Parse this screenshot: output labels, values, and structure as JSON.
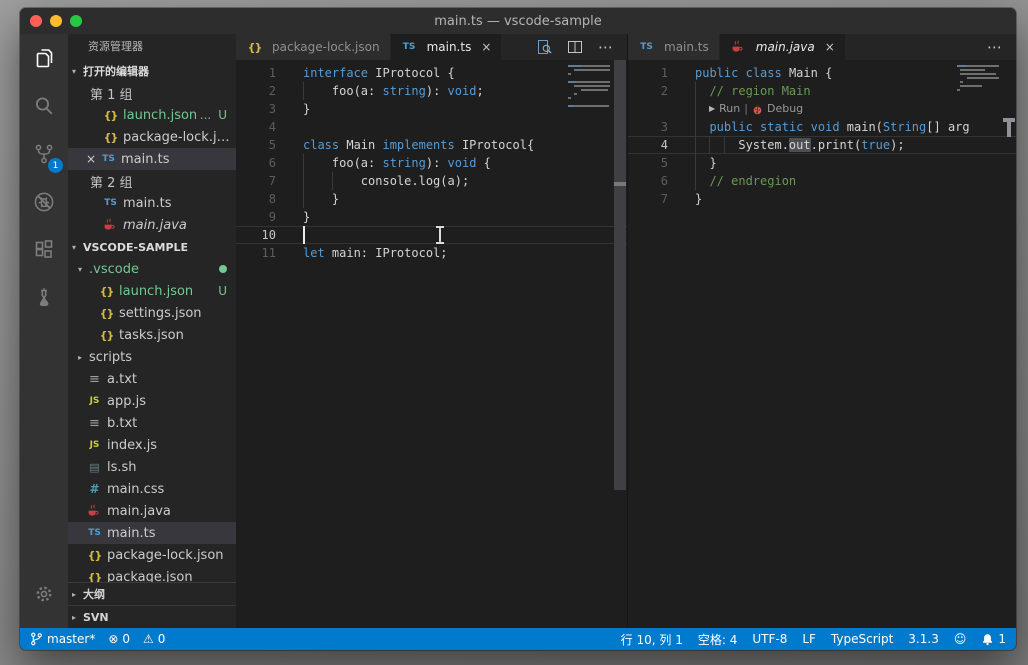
{
  "window": {
    "title": "main.ts — vscode-sample"
  },
  "colors": {
    "accent_blue": "#007acc",
    "editor_bg": "#1e1e1e",
    "sidebar_bg": "#252526",
    "activitybar_bg": "#333333",
    "titlebar_bg": "#2d2d2d",
    "keyword": "#569cd6",
    "comment": "#6a9955",
    "plain_text": "#d4d4d4",
    "git_untracked_green": "#73c991",
    "selection_row": "#37373d",
    "traffic_red": "#ff5f57",
    "traffic_yellow": "#febc2e",
    "traffic_green": "#28c840"
  },
  "activity_bar": {
    "items": [
      {
        "icon": "explorer-icon",
        "active": true
      },
      {
        "icon": "search-icon"
      },
      {
        "icon": "source-control-icon",
        "badge": "1"
      },
      {
        "icon": "debug-icon"
      },
      {
        "icon": "extensions-icon"
      },
      {
        "icon": "test-beaker-icon"
      }
    ],
    "bottom": [
      {
        "icon": "settings-gear-icon"
      }
    ]
  },
  "sidebar": {
    "title": "资源管理器",
    "rows": [
      {
        "kind": "section",
        "arrow": "open",
        "label": "打开的编辑器"
      },
      {
        "kind": "group",
        "label": "第 1 组"
      },
      {
        "kind": "item",
        "lvl": "oe",
        "icon": "json",
        "label": "launch.json",
        "color": "green",
        "badges": [
          "...",
          "U"
        ]
      },
      {
        "kind": "item",
        "lvl": "oe",
        "icon": "json",
        "label": "package-lock.json"
      },
      {
        "kind": "item",
        "lvl": "oe-sel",
        "icon": "ts",
        "label": "main.ts",
        "selected": true,
        "close": true
      },
      {
        "kind": "group",
        "label": "第 2 组"
      },
      {
        "kind": "item",
        "lvl": "oe",
        "icon": "ts",
        "label": "main.ts"
      },
      {
        "kind": "item",
        "lvl": "oe",
        "icon": "java",
        "label": "main.java",
        "italic": true
      },
      {
        "kind": "section",
        "arrow": "open",
        "label": "VSCODE-SAMPLE"
      },
      {
        "kind": "item",
        "lvl": "folder1",
        "arrow": "open",
        "label": ".vscode",
        "color": "green",
        "dot": true
      },
      {
        "kind": "item",
        "lvl": "l2",
        "icon": "json",
        "label": "launch.json",
        "color": "green",
        "badges": [
          "U"
        ]
      },
      {
        "kind": "item",
        "lvl": "l2",
        "icon": "json",
        "label": "settings.json"
      },
      {
        "kind": "item",
        "lvl": "l2",
        "icon": "json",
        "label": "tasks.json"
      },
      {
        "kind": "item",
        "lvl": "folder1",
        "arrow": "closed",
        "label": "scripts"
      },
      {
        "kind": "item",
        "lvl": "l1",
        "icon": "txt",
        "label": "a.txt"
      },
      {
        "kind": "item",
        "lvl": "l1",
        "icon": "js",
        "label": "app.js"
      },
      {
        "kind": "item",
        "lvl": "l1",
        "icon": "txt",
        "label": "b.txt"
      },
      {
        "kind": "item",
        "lvl": "l1",
        "icon": "js",
        "label": "index.js"
      },
      {
        "kind": "item",
        "lvl": "l1",
        "icon": "sh",
        "label": "ls.sh"
      },
      {
        "kind": "item",
        "lvl": "l1",
        "icon": "css",
        "label": "main.css"
      },
      {
        "kind": "item",
        "lvl": "l1",
        "icon": "java",
        "label": "main.java"
      },
      {
        "kind": "item",
        "lvl": "l1",
        "icon": "ts",
        "label": "main.ts",
        "selected": true
      },
      {
        "kind": "item",
        "lvl": "l1",
        "icon": "json",
        "label": "package-lock.json"
      },
      {
        "kind": "item",
        "lvl": "l1",
        "icon": "json",
        "label": "package.json"
      }
    ],
    "bottom_sections": [
      {
        "label": "大纲"
      },
      {
        "label": "SVN"
      }
    ]
  },
  "editors": {
    "left": {
      "tab_size": 4,
      "tabs": [
        {
          "icon": "json",
          "label": "package-lock.json"
        },
        {
          "icon": "ts",
          "label": "main.ts",
          "active": true,
          "close": true
        }
      ],
      "actions": [
        "open-preview-icon",
        "split-editor-icon",
        "more-actions-icon"
      ],
      "lines": [
        {
          "n": "1",
          "segs": [
            [
              "interface",
              "k"
            ],
            [
              " IProtocol {",
              "p"
            ]
          ]
        },
        {
          "n": "2",
          "segs": [
            [
              "    foo(a: ",
              "p"
            ],
            [
              "string",
              "k"
            ],
            [
              "): ",
              "p"
            ],
            [
              "void",
              "k"
            ],
            [
              ";",
              "p"
            ]
          ]
        },
        {
          "n": "3",
          "segs": [
            [
              "}",
              "p"
            ]
          ]
        },
        {
          "n": "4",
          "segs": []
        },
        {
          "n": "5",
          "segs": [
            [
              "class",
              "k"
            ],
            [
              " Main ",
              "p"
            ],
            [
              "implements",
              "k"
            ],
            [
              " IProtocol{",
              "p"
            ]
          ]
        },
        {
          "n": "6",
          "segs": [
            [
              "    foo(a: ",
              "p"
            ],
            [
              "string",
              "k"
            ],
            [
              "): ",
              "p"
            ],
            [
              "void",
              "k"
            ],
            [
              " {",
              "p"
            ]
          ]
        },
        {
          "n": "7",
          "segs": [
            [
              "        console.log(a);",
              "p"
            ]
          ]
        },
        {
          "n": "8",
          "segs": [
            [
              "    }",
              "p"
            ]
          ]
        },
        {
          "n": "9",
          "segs": [
            [
              "}",
              "p"
            ]
          ]
        },
        {
          "n": "10",
          "segs": [],
          "current": true,
          "cursor": true
        },
        {
          "n": "11",
          "segs": [
            [
              "let",
              "k"
            ],
            [
              " main: IProtocol;",
              "p"
            ]
          ]
        }
      ]
    },
    "right": {
      "tab_size": 2,
      "tabs": [
        {
          "icon": "ts",
          "label": "main.ts"
        },
        {
          "icon": "java",
          "label": "main.java",
          "active": true,
          "italic": true,
          "close": true
        }
      ],
      "actions": [
        "more-actions-icon"
      ],
      "codelens": {
        "run": "Run",
        "separator": "|",
        "debug": "Debug"
      },
      "lines": [
        {
          "n": "1",
          "segs": [
            [
              "public",
              "k"
            ],
            [
              " ",
              "p"
            ],
            [
              "class",
              "k"
            ],
            [
              " Main {",
              "p"
            ]
          ]
        },
        {
          "n": "2",
          "segs": [
            [
              "  // region Main",
              "c"
            ]
          ]
        },
        {
          "codelens": true
        },
        {
          "n": "3",
          "segs": [
            [
              "  ",
              "p"
            ],
            [
              "public",
              "k"
            ],
            [
              " ",
              "p"
            ],
            [
              "static",
              "k"
            ],
            [
              " ",
              "p"
            ],
            [
              "void",
              "k"
            ],
            [
              " main(",
              "p"
            ],
            [
              "String",
              "k"
            ],
            [
              "[] arg",
              "p"
            ]
          ]
        },
        {
          "n": "4",
          "segs": [
            [
              "      System.",
              "p"
            ],
            [
              "out",
              "h"
            ],
            [
              ".print(",
              "p"
            ],
            [
              "true",
              "k"
            ],
            [
              ");",
              "p"
            ]
          ],
          "current": true
        },
        {
          "n": "5",
          "segs": [
            [
              "  }",
              "p"
            ]
          ]
        },
        {
          "n": "6",
          "segs": [
            [
              "  // endregion",
              "c"
            ]
          ]
        },
        {
          "n": "7",
          "segs": [
            [
              "}",
              "p"
            ]
          ]
        }
      ]
    }
  },
  "status_bar": {
    "left": [
      {
        "icon": "git-branch-icon",
        "label": "master*"
      },
      {
        "icon": "error-icon",
        "label": "0"
      },
      {
        "icon": "warning-icon",
        "label": "0"
      }
    ],
    "right": [
      {
        "label": "行 10, 列 1"
      },
      {
        "label": "空格: 4"
      },
      {
        "label": "UTF-8"
      },
      {
        "label": "LF"
      },
      {
        "label": "TypeScript"
      },
      {
        "label": "3.1.3"
      },
      {
        "icon": "smiley-icon"
      },
      {
        "icon": "bell-icon",
        "label": "1"
      }
    ]
  }
}
